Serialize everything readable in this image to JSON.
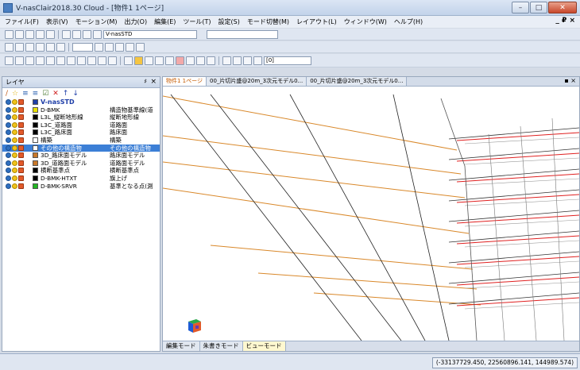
{
  "window": {
    "title": "V-nasClair2018.30 Cloud - [物件1 1ページ]",
    "minimize": "–",
    "maximize": "□",
    "close": "✕"
  },
  "menu": [
    "ファイル(F)",
    "表示(V)",
    "モーション(M)",
    "出力(O)",
    "編集(E)",
    "ツール(T)",
    "設定(S)",
    "モード切替(M)",
    "レイアウト(L)",
    "ウィンドウ(W)",
    "ヘルプ(H)"
  ],
  "menu_right": "_ ₽ ×",
  "toolbar": {
    "layer_combo": "V-nasSTD",
    "page_field": "[0]"
  },
  "panel": {
    "title": "レイヤ",
    "pin": "♯",
    "close": "×",
    "tools": [
      "/",
      "☆",
      "≡",
      "≡",
      "☑",
      "✕",
      "↑",
      "↓"
    ]
  },
  "layers": [
    {
      "name": "V-nasSTD",
      "desc": "",
      "color": "#1f3fa8",
      "root": true
    },
    {
      "name": "D-BMK",
      "desc": "構造物基準線(道",
      "color": "#e8e000"
    },
    {
      "name": "L3L_縦断地形線",
      "desc": "縦断地形線",
      "color": "#000000"
    },
    {
      "name": "L3C_道路面",
      "desc": "道路面",
      "color": "#000000"
    },
    {
      "name": "L3C_路床面",
      "desc": "路床面",
      "color": "#000000"
    },
    {
      "name": "構築",
      "desc": "構築",
      "color": "#ffffff"
    },
    {
      "name": "その他の構造物",
      "desc": "その他の構造物",
      "color": "#ffffff",
      "selected": true
    },
    {
      "name": "3D_路床面モデル",
      "desc": "路床面モデル",
      "color": "#c8782a"
    },
    {
      "name": "3D_道路面モデル",
      "desc": "道路面モデル",
      "color": "#c8782a"
    },
    {
      "name": "横断基準点",
      "desc": "横断基準点",
      "color": "#000000"
    },
    {
      "name": "D-BMK-HTXT",
      "desc": "旗上げ",
      "color": "#000000"
    },
    {
      "name": "D-BMK-SRVR",
      "desc": "基準となる点(測",
      "color": "#22b522"
    }
  ],
  "view_tabs": [
    "物件1 1ページ",
    "00_片切片盛@20m_3次元モデル0...",
    "00_片切片盛@20m_3次元モデル0..."
  ],
  "view_tab_close": "▪ ×",
  "mode_tabs": [
    "編集モード",
    "朱書きモード",
    "ビューモード"
  ],
  "status": {
    "coords": "(-33137729.450, 22560896.141, 144989.574)"
  },
  "colors": {
    "accent": "#3c7fd6",
    "orange_line": "#d9882a",
    "red_line": "#e02020"
  }
}
